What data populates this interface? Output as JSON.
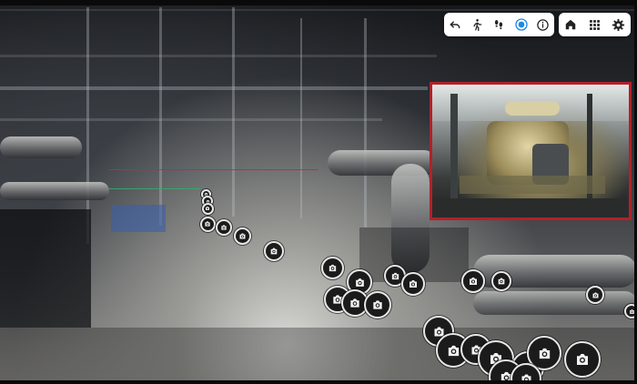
{
  "viewer": {
    "navigation_toolbar": [
      {
        "icon": "undo-icon"
      },
      {
        "icon": "walk-mode-icon"
      },
      {
        "icon": "footsteps-icon"
      },
      {
        "icon": "point-cloud-mode-icon",
        "active": true
      },
      {
        "icon": "info-icon"
      }
    ],
    "app_toolbar": [
      {
        "icon": "home-icon"
      },
      {
        "icon": "grid-apps-icon"
      },
      {
        "icon": "settings-gear-icon"
      }
    ],
    "camera_inset": {
      "border_color": "#b3202a"
    },
    "camera_markers": {
      "count": 27,
      "icon": "camera-icon"
    }
  },
  "colors": {
    "toolbar_bg": "#ffffff",
    "active_accent": "#1e88e5",
    "marker_fill": "#1b1b1b",
    "marker_ring": "#e8e8e8"
  }
}
